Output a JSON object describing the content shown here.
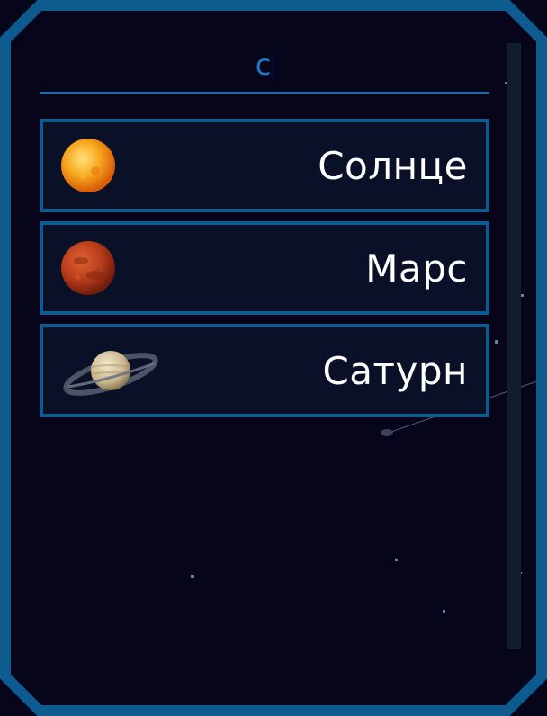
{
  "search": {
    "value": "с"
  },
  "planets": [
    {
      "name": "Солнце",
      "icon": "sun-icon"
    },
    {
      "name": "Марс",
      "icon": "mars-icon"
    },
    {
      "name": "Сатурн",
      "icon": "saturn-icon"
    }
  ],
  "colors": {
    "frame": "#0e5b8f",
    "background": "#06051a",
    "accent": "#1f78c4",
    "text": "#ffffff"
  }
}
